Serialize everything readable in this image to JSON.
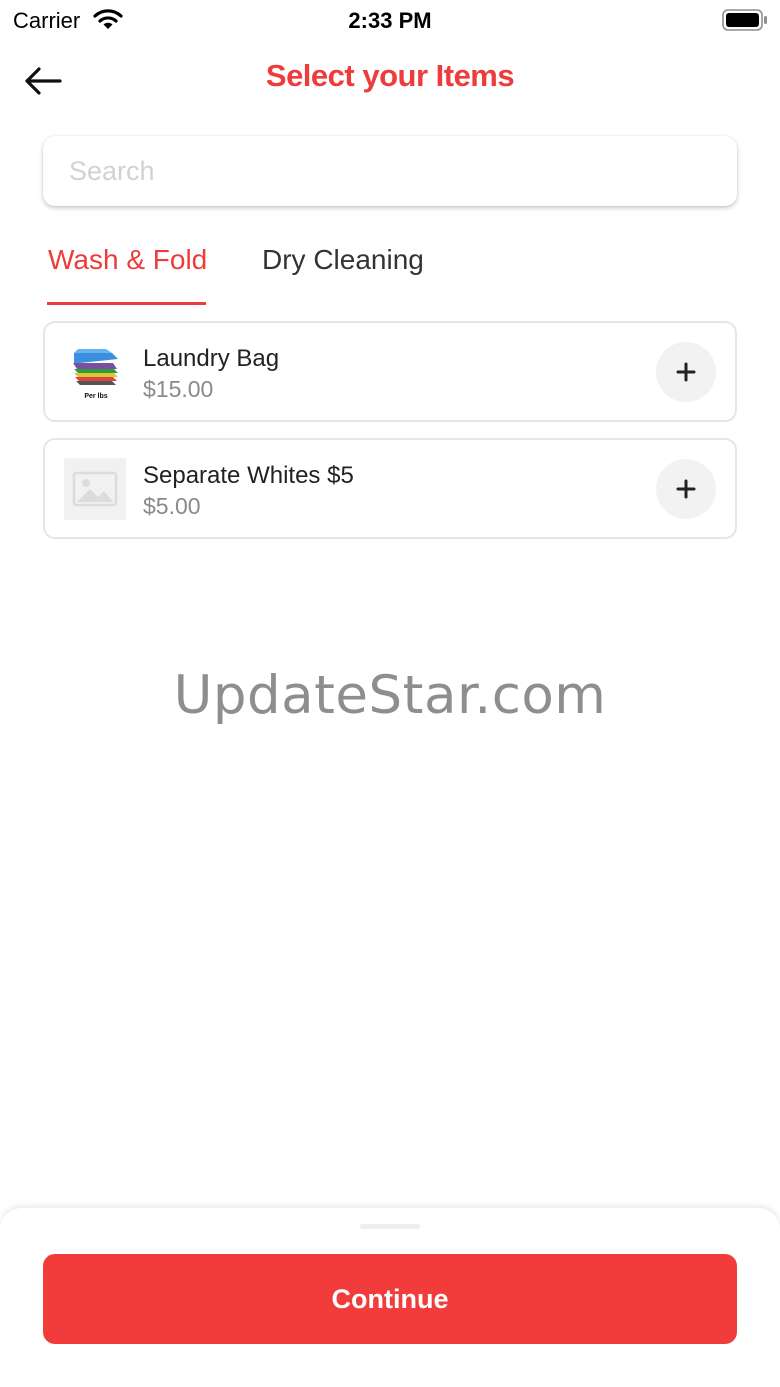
{
  "status_bar": {
    "carrier": "Carrier",
    "time": "2:33 PM",
    "wifi_icon": "wifi-icon",
    "battery_icon": "battery-icon"
  },
  "header": {
    "back_icon": "arrow-left-icon",
    "title": "Select your Items"
  },
  "search": {
    "placeholder": "Search",
    "value": ""
  },
  "tabs": [
    {
      "label": "Wash & Fold",
      "active": true
    },
    {
      "label": "Dry Cleaning",
      "active": false
    }
  ],
  "items": [
    {
      "name": "Laundry Bag",
      "price": "$15.00",
      "thumb_icon": "folded-clothes-icon",
      "thumb_caption": "Per lbs",
      "action_icon": "plus-icon"
    },
    {
      "name": "Separate Whites $5",
      "price": "$5.00",
      "thumb_icon": "image-placeholder-icon",
      "action_icon": "plus-icon"
    }
  ],
  "watermark": "UpdateStar.com",
  "footer": {
    "continue_label": "Continue"
  },
  "colors": {
    "accent": "#ee3b3b",
    "button": "#f23b3b",
    "muted_text": "#8a8a8a"
  }
}
